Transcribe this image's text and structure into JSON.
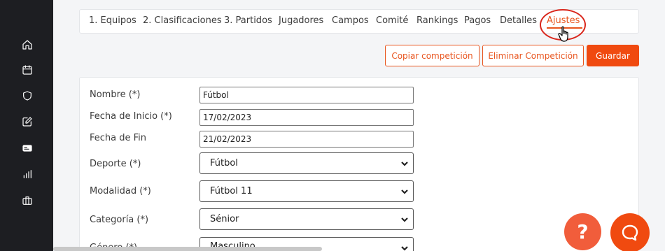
{
  "sidebar": {
    "icons": [
      "home-icon",
      "calendar-icon",
      "shield-icon",
      "edit-icon",
      "id-card-icon",
      "bar-chart-icon",
      "briefcase-icon"
    ]
  },
  "tabs": [
    {
      "label": "1. Equipos"
    },
    {
      "label": "2. Clasificaciones"
    },
    {
      "label": "3. Partidos"
    },
    {
      "label": "Jugadores"
    },
    {
      "label": "Campos"
    },
    {
      "label": "Comité"
    },
    {
      "label": "Rankings"
    },
    {
      "label": "Pagos"
    },
    {
      "label": "Detalles"
    },
    {
      "label": "Ajustes",
      "active": true
    }
  ],
  "actions": {
    "copy_label": "Copiar competición",
    "delete_label": "Eliminar Competición",
    "save_label": "Guardar"
  },
  "form": {
    "nombre": {
      "label": "Nombre (*)",
      "value": "Fútbol"
    },
    "fecha_inicio": {
      "label": "Fecha de Inicio (*)",
      "value": "17/02/2023"
    },
    "fecha_fin": {
      "label": "Fecha de Fin",
      "value": "21/02/2023"
    },
    "deporte": {
      "label": "Deporte (*)",
      "value": "Fútbol"
    },
    "modalidad": {
      "label": "Modalidad (*)",
      "value": "Fútbol 11"
    },
    "categoria": {
      "label": "Categoría (*)",
      "value": "Sénior"
    },
    "genero": {
      "label": "Género (*)",
      "value": "Masculino"
    }
  },
  "floating": {
    "help_label": "?"
  },
  "colors": {
    "accent": "#e8541d",
    "primary_button": "#f04a10",
    "sidebar": "#1d1e22",
    "highlight_ring": "#d9261c"
  }
}
